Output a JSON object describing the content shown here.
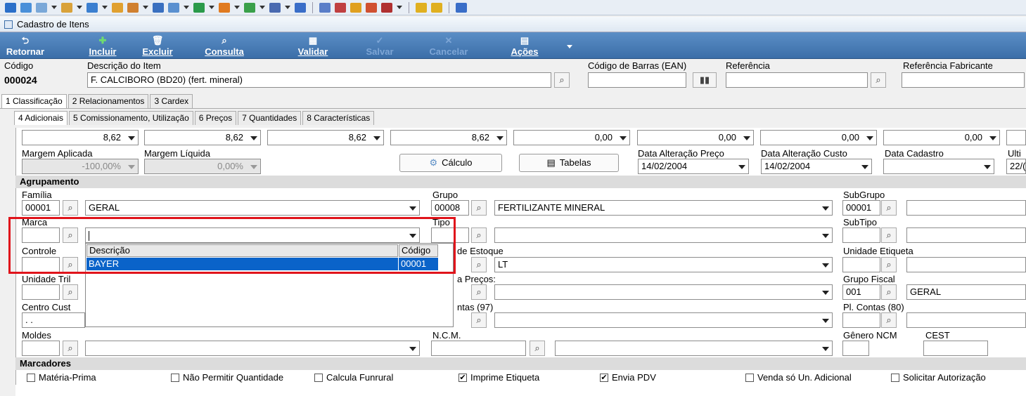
{
  "window": {
    "title": "Cadastro de Itens"
  },
  "toolbar_icons": [
    "folder-icon",
    "people-icon",
    "grid-icon",
    "list-icon",
    "doc-icon",
    "truck-icon",
    "person-icon",
    "calc-icon",
    "table-icon",
    "cart-icon",
    "box-icon",
    "plant-icon",
    "printer-icon",
    "chart-icon",
    "invoice-icon",
    "calendar-icon",
    "tools-icon",
    "coins-icon",
    "book-icon",
    "star-icon",
    "star-icon",
    "info-icon"
  ],
  "ribbon": {
    "retornar": "Retornar",
    "incluir": "Incluir",
    "excluir": "Excluir",
    "consulta": "Consulta",
    "validar": "Validar",
    "salvar": "Salvar",
    "cancelar": "Cancelar",
    "acoes": "Ações"
  },
  "header": {
    "codigo_label": "Código",
    "codigo_value": "000024",
    "descricao_label": "Descrição do Item",
    "descricao_value": "F. CALCIBORO (BD20) (fert. mineral)",
    "ean_label": "Código de Barras (EAN)",
    "ref_label": "Referência",
    "reffab_label": "Referência Fabricante"
  },
  "tabs1": [
    "1 Classificação",
    "2 Relacionamentos",
    "3 Cardex"
  ],
  "tabs2": [
    "4 Adicionais",
    "5 Comissionamento, Utilização",
    "6 Preços",
    "7 Quantidades",
    "8 Características"
  ],
  "prices": {
    "p1": "8,62",
    "p2": "8,62",
    "p3": "8,62",
    "p4": "8,62",
    "p5": "0,00",
    "p6": "0,00",
    "p7": "0,00",
    "p8": "0,00"
  },
  "margens": {
    "aplicada_label": "Margem Aplicada",
    "aplicada_value": "-100,00%",
    "liquida_label": "Margem Líquida",
    "liquida_value": "0,00%"
  },
  "buttons": {
    "calculo": "Cálculo",
    "tabelas": "Tabelas"
  },
  "dates": {
    "alt_preco_label": "Data Alteração Preço",
    "alt_preco_value": "14/02/2004",
    "alt_custo_label": "Data Alteração Custo",
    "alt_custo_value": "14/02/2004",
    "cadastro_label": "Data Cadastro",
    "ult_label": "Ulti",
    "ult_value": "22/("
  },
  "agrupamento": {
    "title": "Agrupamento",
    "familia_label": "Família",
    "familia_code": "00001",
    "familia_desc": "GERAL",
    "grupo_label": "Grupo",
    "grupo_code": "00008",
    "grupo_desc": "FERTILIZANTE MINERAL",
    "subgrupo_label": "SubGrupo",
    "subgrupo_code": "00001",
    "marca_label": "Marca",
    "tipo_label": "Tipo",
    "subtipo_label": "SubTipo",
    "controle_label": "Controle",
    "estoque_label": "de Estoque",
    "estoque_value": "LT",
    "unid_etiq_label": "Unidade Etiqueta",
    "unid_trib_label": "Unidade Tril",
    "precos_label": "a Preços:",
    "grupo_fiscal_label": "Grupo Fiscal",
    "grupo_fiscal_code": "001",
    "grupo_fiscal_desc": "GERAL",
    "centro_label": "Centro Cust",
    "centro_value": ". .",
    "contas97_label": "ntas (97)",
    "contas80_label": "Pl. Contas (80)",
    "moldes_label": "Moldes",
    "ncm_label": "N.C.M.",
    "genero_label": "Gênero NCM",
    "cest_label": "CEST"
  },
  "popup": {
    "col_desc": "Descrição",
    "col_code": "Código",
    "row_desc": "BAYER",
    "row_code": "00001"
  },
  "marcadores": {
    "title": "Marcadores",
    "items": [
      {
        "label": "Matéria-Prima",
        "checked": false
      },
      {
        "label": "Não Permitir Quantidade",
        "checked": false
      },
      {
        "label": "Calcula Funrural",
        "checked": false
      },
      {
        "label": "Imprime Etiqueta",
        "checked": true
      },
      {
        "label": "Envia PDV",
        "checked": true
      },
      {
        "label": "Venda só Un. Adicional",
        "checked": false
      },
      {
        "label": "Solicitar Autorização",
        "checked": false
      }
    ]
  },
  "colors": {
    "ribbon": "#4a7fb8",
    "highlight": "#e0141b",
    "selection": "#0a63c9"
  }
}
